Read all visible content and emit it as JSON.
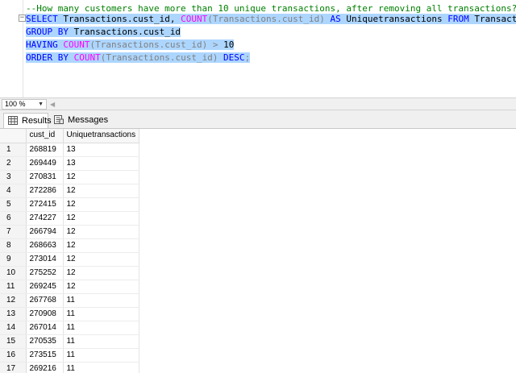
{
  "editor": {
    "comment": "--How many customers have more than 10 unique transactions, after removing all transactions?",
    "select_kw": "SELECT",
    "select_col": " Transactions.cust_id, ",
    "count_fn": "COUNT",
    "count_arg": "(Transactions.cust_id)",
    "as_kw": " AS ",
    "alias": "Uniquetransactions",
    "from_kw": " FROM",
    "from_table": " Transactions",
    "group_kw": "GROUP BY",
    "group_col": " Transactions.cust_id",
    "having_kw": "HAVING",
    "having_fn": " COUNT",
    "having_arg": "(Transactions.cust_id)",
    "having_op": " > ",
    "having_val": "10",
    "order_kw": "ORDER BY",
    "order_fn": " COUNT",
    "order_arg": "(Transactions.cust_id)",
    "desc_kw": " DESC",
    "terminator": ";"
  },
  "zoom": {
    "value": "100 %"
  },
  "tabs": {
    "results": "Results",
    "messages": "Messages"
  },
  "grid": {
    "headers": [
      "cust_id",
      "Uniquetransactions"
    ],
    "rows": [
      [
        "1",
        "268819",
        "13"
      ],
      [
        "2",
        "269449",
        "13"
      ],
      [
        "3",
        "270831",
        "12"
      ],
      [
        "4",
        "272286",
        "12"
      ],
      [
        "5",
        "272415",
        "12"
      ],
      [
        "6",
        "274227",
        "12"
      ],
      [
        "7",
        "266794",
        "12"
      ],
      [
        "8",
        "268663",
        "12"
      ],
      [
        "9",
        "273014",
        "12"
      ],
      [
        "10",
        "275252",
        "12"
      ],
      [
        "11",
        "269245",
        "12"
      ],
      [
        "12",
        "267768",
        "11"
      ],
      [
        "13",
        "270908",
        "11"
      ],
      [
        "14",
        "267014",
        "11"
      ],
      [
        "15",
        "270535",
        "11"
      ],
      [
        "16",
        "273515",
        "11"
      ],
      [
        "17",
        "269216",
        "11"
      ]
    ]
  },
  "colors": {
    "selection": "#add6ff",
    "keyword": "#0000ff",
    "function": "#ff00ff",
    "comment": "#008000",
    "operator": "#808080"
  }
}
